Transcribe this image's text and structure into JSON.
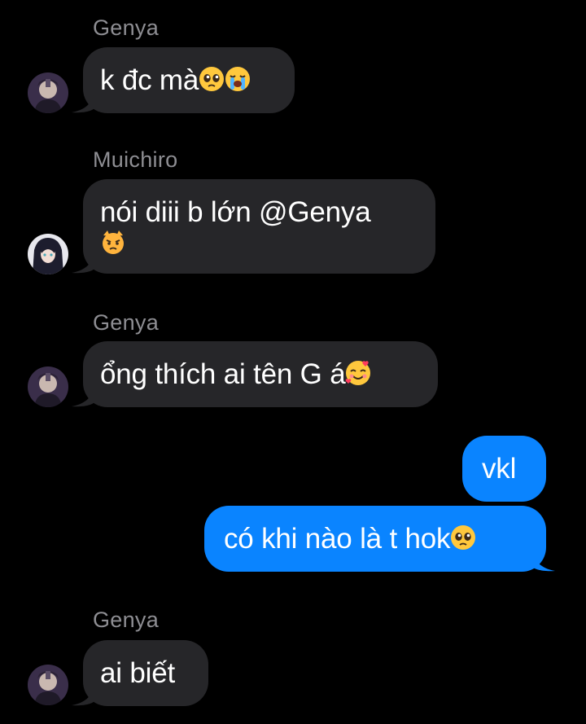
{
  "messages": [
    {
      "sender": "Genya",
      "text": "k đc mà",
      "emoji": [
        "pleading-face-icon",
        "loudly-crying-face-icon"
      ]
    },
    {
      "sender": "Muichiro",
      "line1": "nói diii b lớn @Genya",
      "emoji": [
        "pouting-cat-face-icon"
      ]
    },
    {
      "sender": "Genya",
      "text": "ổng thích ai tên G á",
      "emoji": [
        "smiling-face-with-hearts-icon"
      ]
    },
    {
      "sender": "me",
      "text": "vkl"
    },
    {
      "sender": "me",
      "text": "có khi nào là t hok",
      "emoji": [
        "pleading-face-icon"
      ]
    },
    {
      "sender": "Genya",
      "text": "ai biết"
    }
  ],
  "colors": {
    "background": "#000000",
    "incoming_bubble": "#262629",
    "outgoing_bubble": "#0a84ff",
    "sender_name": "#8e8e93"
  }
}
